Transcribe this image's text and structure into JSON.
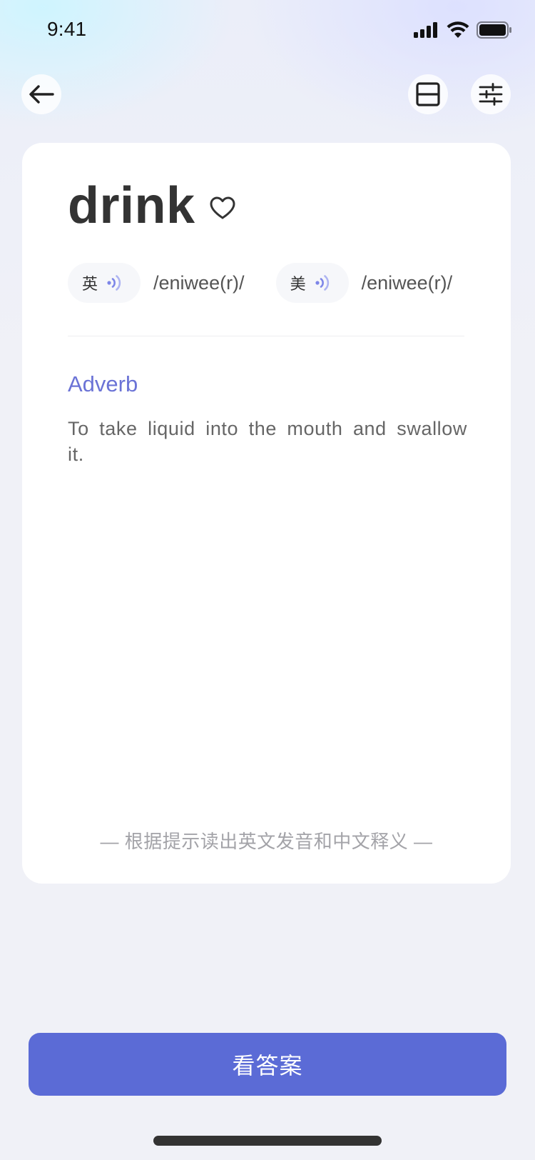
{
  "status_bar": {
    "time": "9:41"
  },
  "header": {
    "back_icon": "arrow-left-icon",
    "layout_icon": "split-layout-icon",
    "settings_icon": "sliders-icon"
  },
  "card": {
    "word": "drink",
    "favorite_icon": "heart-outline-icon",
    "phonetics": [
      {
        "region": "英",
        "ipa": "/eniwee(r)/",
        "icon": "speaker-wave-icon"
      },
      {
        "region": "美",
        "ipa": "/eniwee(r)/",
        "icon": "speaker-wave-icon"
      }
    ],
    "part_of_speech": "Adverb",
    "definition": "To take liquid into the mouth and swallow it.",
    "hint": "— 根据提示读出英文发音和中文释义 —"
  },
  "footer": {
    "answer_button_label": "看答案"
  },
  "colors": {
    "accent": "#5B6BD6",
    "pos_text": "#6B73D6",
    "background": "#F0F1F7",
    "card": "#FFFFFF"
  }
}
